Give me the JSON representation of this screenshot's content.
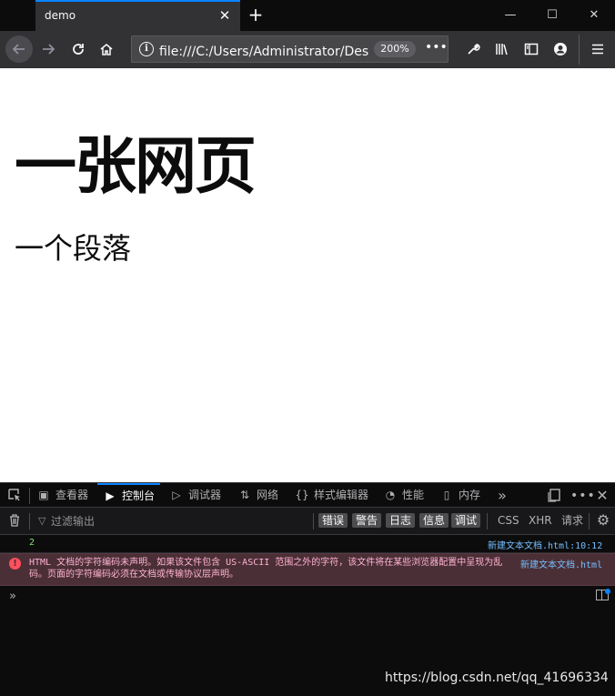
{
  "browser": {
    "tab_title": "demo",
    "tab_close_glyph": "✕",
    "new_tab_glyph": "+",
    "window_controls": {
      "minimize": "—",
      "maximize": "☐",
      "close": "✕"
    },
    "url": "file:///C:/Users/Administrator/Desktop/新建文本文档.html",
    "zoom_level": "200%",
    "page_actions_glyph": "•••",
    "accent_color": "#0a84ff"
  },
  "page": {
    "heading": "一张网页",
    "paragraph": "一个段落"
  },
  "devtools": {
    "tabs": [
      {
        "label": "查看器",
        "icon": "inspector-icon"
      },
      {
        "label": "控制台",
        "icon": "console-icon"
      },
      {
        "label": "调试器",
        "icon": "debugger-icon"
      },
      {
        "label": "网络",
        "icon": "network-icon"
      },
      {
        "label": "样式编辑器",
        "icon": "style-editor-icon"
      },
      {
        "label": "性能",
        "icon": "performance-icon"
      },
      {
        "label": "内存",
        "icon": "memory-icon"
      }
    ],
    "active_tab": "控制台",
    "filter_placeholder": "过滤输出",
    "filter_chips": [
      "错误",
      "警告",
      "日志",
      "信息",
      "调试"
    ],
    "type_buttons": [
      "CSS",
      "XHR",
      "请求"
    ]
  },
  "console": {
    "messages": [
      {
        "type": "log",
        "text": "2",
        "source": "新建文本文档.html:10:12"
      },
      {
        "type": "error",
        "text": "HTML 文档的字符编码未声明。如果该文件包含 US-ASCII 范围之外的字符，该文件将在某些浏览器配置中呈现为乱码。页面的字符编码必须在文档或传输协议层声明。",
        "source": "新建文本文档.html"
      }
    ],
    "prompt": "»"
  },
  "watermark": "https://blog.csdn.net/qq_41696334"
}
